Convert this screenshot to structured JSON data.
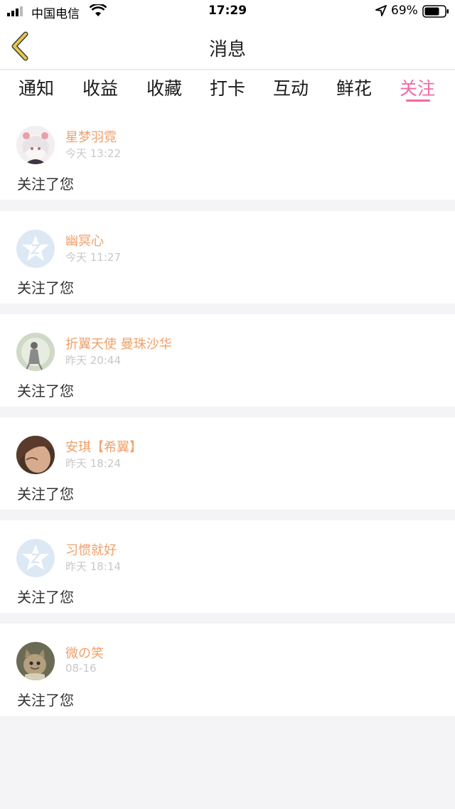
{
  "status_bar": {
    "carrier": "中国电信",
    "time": "17:29",
    "battery": "69%"
  },
  "header": {
    "title": "消息"
  },
  "tabs": [
    {
      "label": "通知",
      "active": false
    },
    {
      "label": "收益",
      "active": false
    },
    {
      "label": "收藏",
      "active": false
    },
    {
      "label": "打卡",
      "active": false
    },
    {
      "label": "互动",
      "active": false
    },
    {
      "label": "鲜花",
      "active": false
    },
    {
      "label": "关注",
      "active": true
    }
  ],
  "colors": {
    "accent": "#f06aa6",
    "name": "#f0a06a",
    "back_icon": "#e8c84a"
  },
  "notifications": [
    {
      "name": "星梦羽霓",
      "time": "今天 13:22",
      "message": "关注了您",
      "avatar": "anime-girl-avatar"
    },
    {
      "name": "幽冥心",
      "time": "今天 11:27",
      "message": "关注了您",
      "avatar": "default-q-avatar"
    },
    {
      "name": "折翼天使 曼珠沙华",
      "time": "昨天 20:44",
      "message": "关注了您",
      "avatar": "figure-avatar"
    },
    {
      "name": "安琪【希翼】",
      "time": "昨天 18:24",
      "message": "关注了您",
      "avatar": "photo-avatar"
    },
    {
      "name": "习惯就好",
      "time": "昨天 18:14",
      "message": "关注了您",
      "avatar": "default-q-avatar"
    },
    {
      "name": "微の笑",
      "time": "08-16",
      "message": "关注了您",
      "avatar": "kitten-avatar"
    }
  ]
}
